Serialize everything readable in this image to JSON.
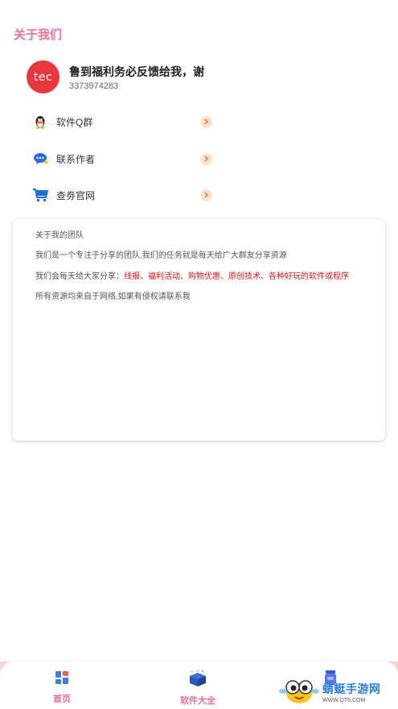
{
  "header": {
    "title": "关于我们"
  },
  "profile": {
    "avatar_text": "tec",
    "name": "鲁到福利务必反馈给我，谢",
    "id": "3373974283"
  },
  "menu": {
    "items": [
      {
        "label": "软件Q群",
        "icon": "qq-penguin-icon"
      },
      {
        "label": "联系作者",
        "icon": "chat-bubble-icon"
      },
      {
        "label": "查劵官网",
        "icon": "shopping-cart-icon"
      }
    ]
  },
  "about": {
    "heading": "关于我的团队",
    "line1": "我们是一个专注于分享的团队,我们的任务就是每天给广大群友分享资源",
    "line2_prefix": "我们会每天给大家分享：",
    "line2_highlight": "线报、福利活动、购物优惠、原创技术、各种好玩的软件或程序",
    "line3": "所有资源均来自于网络,如果有侵权请联系我"
  },
  "tabbar": {
    "tabs": [
      {
        "label": "首页",
        "icon": "home-grid-icon"
      },
      {
        "label": "软件大全",
        "icon": "gift-box-icon"
      },
      {
        "label": "",
        "icon": "jar-icon"
      }
    ]
  },
  "watermark": {
    "title": "蜻蜓手游网",
    "url": "WWW.QT6.COM"
  },
  "colors": {
    "accent": "#ef6f9a",
    "highlight": "#e0151c",
    "avatar_bg": "#e8383d",
    "watermark": "#2a7de0"
  }
}
